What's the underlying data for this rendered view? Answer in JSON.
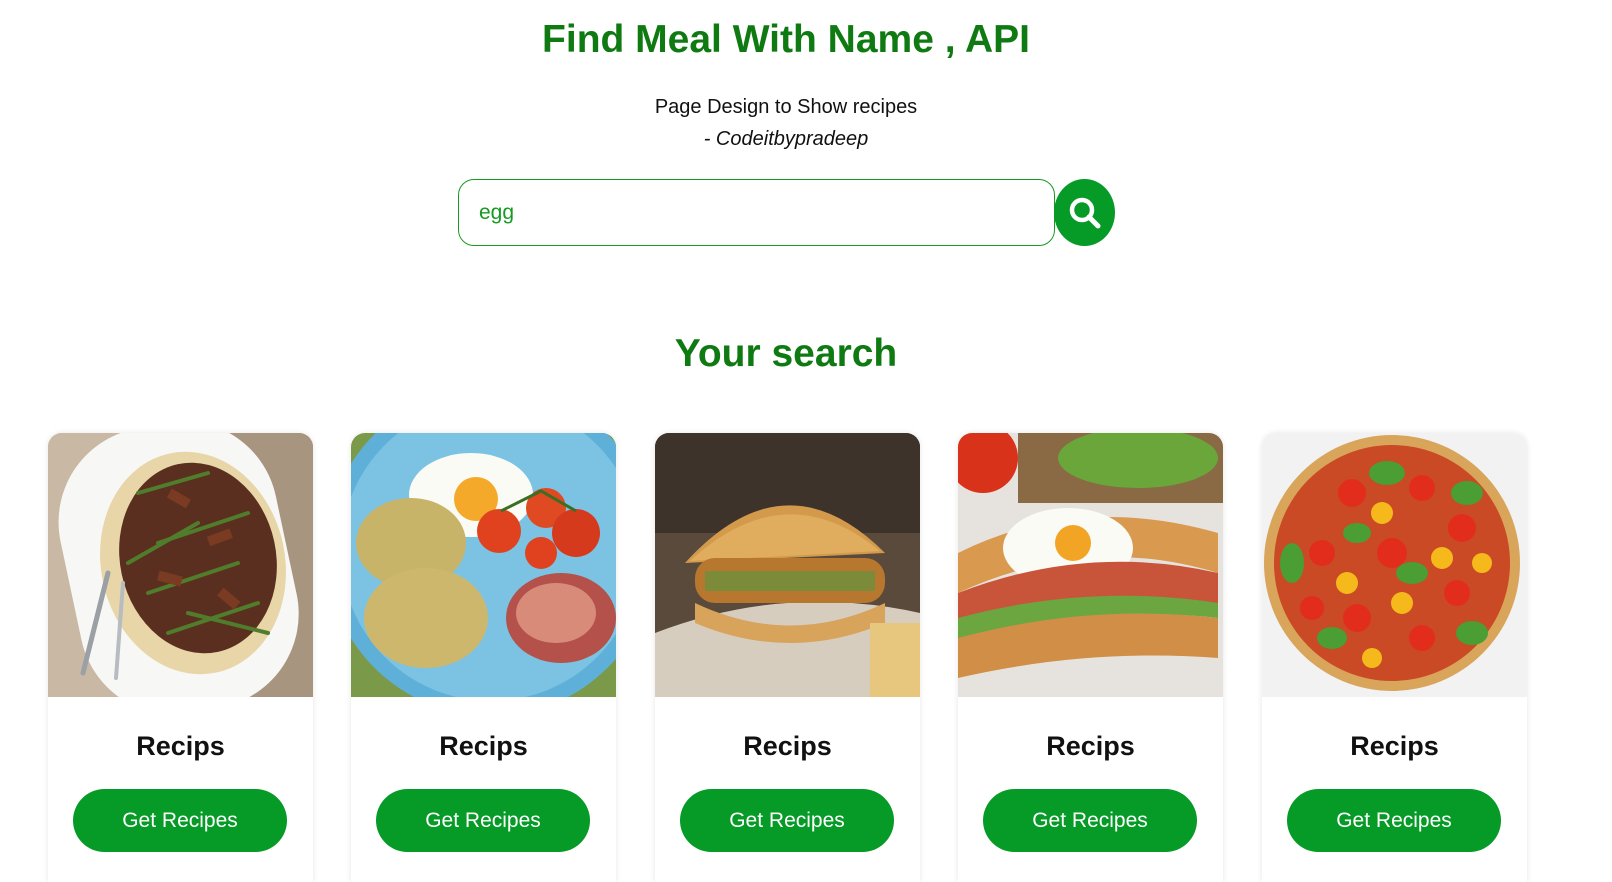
{
  "header": {
    "title": "Find Meal With Name , API",
    "subtitle": "Page Design to Show recipes",
    "author": "- Codeitbypradeep"
  },
  "search": {
    "value": "egg",
    "button_icon": "search-icon"
  },
  "results": {
    "title": "Your search",
    "cards": [
      {
        "label": "Recips",
        "button": "Get Recipes",
        "image": "beef-asparagus-platter"
      },
      {
        "label": "Recips",
        "button": "Get Recipes",
        "image": "fried-egg-breakfast-plate"
      },
      {
        "label": "Recips",
        "button": "Get Recipes",
        "image": "crispy-chicken-burger"
      },
      {
        "label": "Recips",
        "button": "Get Recipes",
        "image": "egg-steak-sandwich"
      },
      {
        "label": "Recips",
        "button": "Get Recipes",
        "image": "tomato-basil-tart"
      }
    ]
  },
  "colors": {
    "accent": "#069a27",
    "heading": "#0f7a12"
  }
}
